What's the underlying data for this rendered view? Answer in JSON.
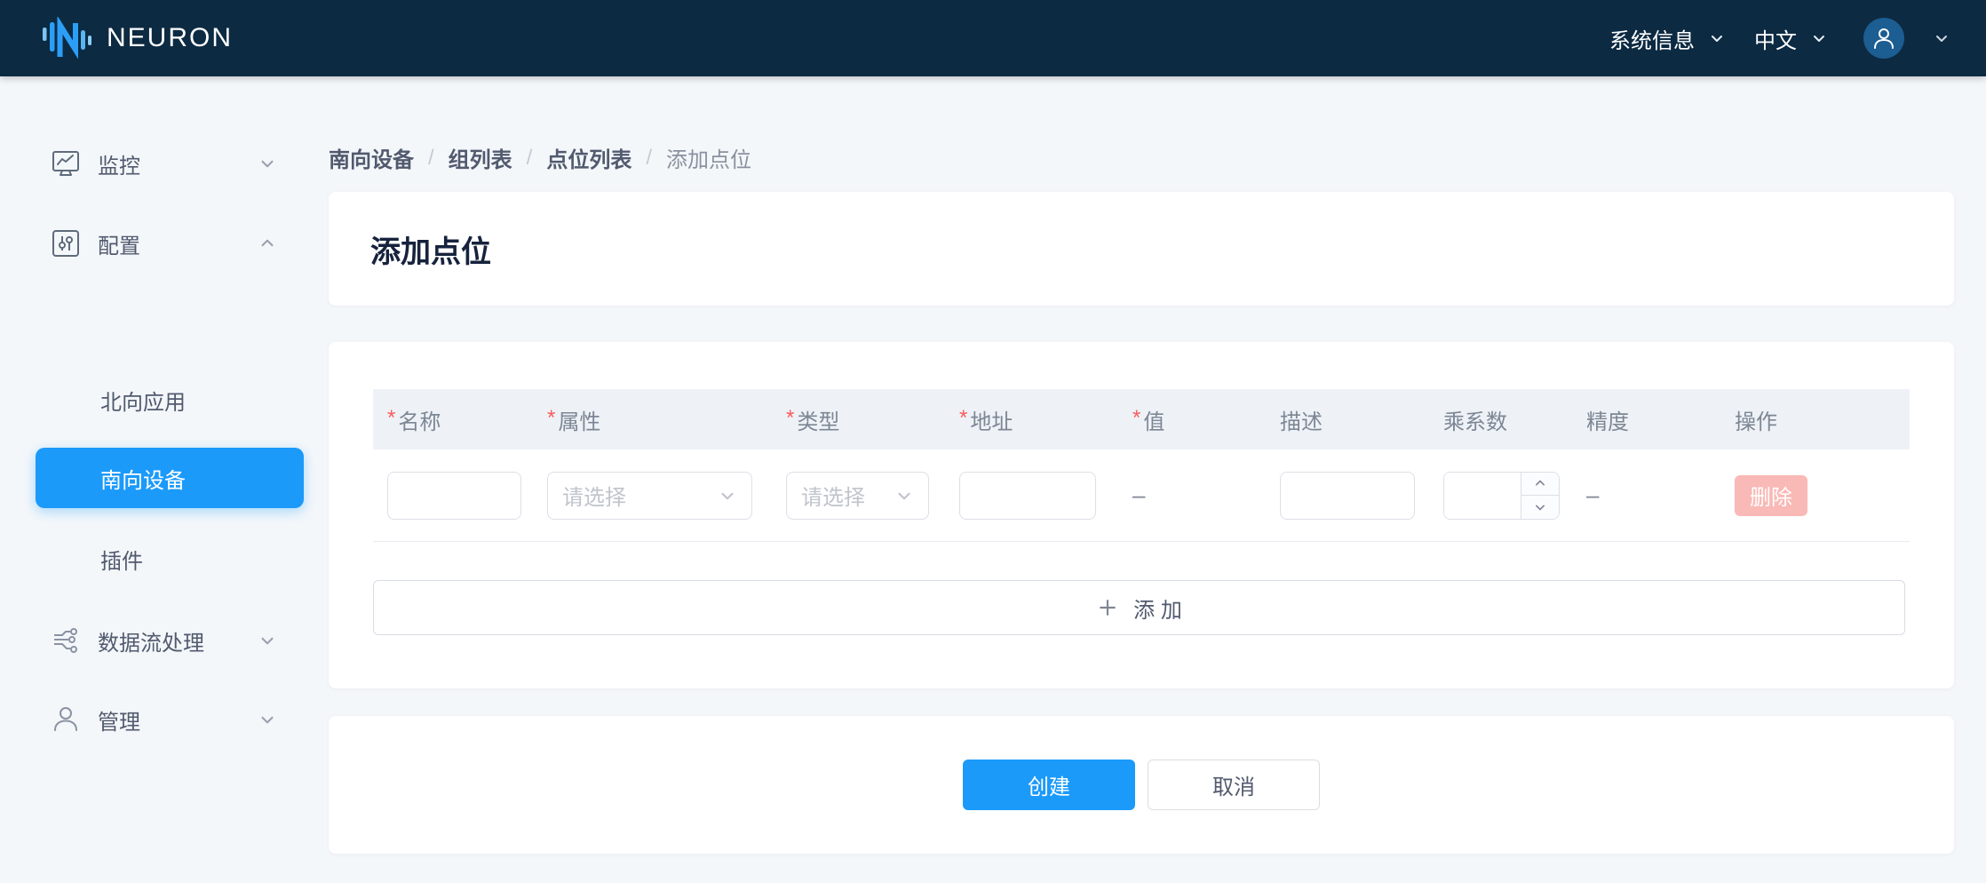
{
  "header": {
    "brand": "NEURON",
    "system_info_label": "系统信息",
    "language_label": "中文"
  },
  "sidebar": {
    "monitor_label": "监控",
    "config_label": "配置",
    "north_apps_label": "北向应用",
    "south_devices_label": "南向设备",
    "plugins_label": "插件",
    "dataflow_label": "数据流处理",
    "admin_label": "管理"
  },
  "breadcrumb": {
    "separator": "/",
    "items": [
      "南向设备",
      "组列表",
      "点位列表",
      "添加点位"
    ]
  },
  "page": {
    "title": "添加点位"
  },
  "table": {
    "required_marker": "*",
    "columns": [
      {
        "label": "名称",
        "required": true
      },
      {
        "label": "属性",
        "required": true
      },
      {
        "label": "类型",
        "required": true
      },
      {
        "label": "地址",
        "required": true
      },
      {
        "label": "值",
        "required": true
      },
      {
        "label": "描述",
        "required": false
      },
      {
        "label": "乘系数",
        "required": false
      },
      {
        "label": "精度",
        "required": false
      },
      {
        "label": "操作",
        "required": false
      }
    ],
    "row": {
      "attribute_placeholder": "请选择",
      "type_placeholder": "请选择",
      "value_text": "–",
      "precision_text": "–",
      "delete_label": "删除"
    },
    "add_button_label": "添 加"
  },
  "actions": {
    "create_label": "创建",
    "cancel_label": "取消"
  },
  "colors": {
    "primary": "#1b9afa",
    "header_bg": "#0c2a42",
    "page_bg": "#f4f7fa",
    "required": "#fa5d5d",
    "delete_disabled_bg": "#f9b9b6",
    "thead_bg": "#eef2f7"
  }
}
